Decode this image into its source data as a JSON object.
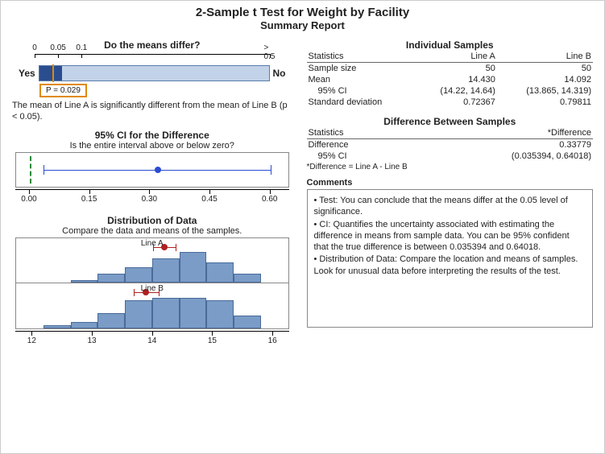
{
  "header": {
    "title": "2-Sample t Test for Weight by Facility",
    "subtitle": "Summary Report"
  },
  "means_differ": {
    "title": "Do the means differ?",
    "yes": "Yes",
    "no": "No",
    "p_label": "P = 0.029",
    "scale_labels": [
      "0",
      "0.05",
      "0.1",
      "> 0.5"
    ],
    "description": "The mean of Line A is significantly different from the mean of Line B (p < 0.05)."
  },
  "ci": {
    "title": "95% CI for the Difference",
    "subtitle": "Is the entire interval above or below zero?",
    "axis_labels": [
      "0.00",
      "0.15",
      "0.30",
      "0.45",
      "0.60"
    ]
  },
  "dist": {
    "title": "Distribution of Data",
    "subtitle": "Compare the data and means of the samples.",
    "label_a": "Line A",
    "label_b": "Line B",
    "axis_labels": [
      "12",
      "13",
      "14",
      "15",
      "16"
    ]
  },
  "individual": {
    "title": "Individual Samples",
    "h_stats": "Statistics",
    "h_a": "Line A",
    "h_b": "Line B",
    "r1": "Sample size",
    "r1a": "50",
    "r1b": "50",
    "r2": "Mean",
    "r2a": "14.430",
    "r2b": "14.092",
    "r3": "95% CI",
    "r3a": "(14.22, 14.64)",
    "r3b": "(13.865, 14.319)",
    "r4": "Standard deviation",
    "r4a": "0.72367",
    "r4b": "0.79811"
  },
  "diff": {
    "title": "Difference Between Samples",
    "h_stats": "Statistics",
    "h_diff": "*Difference",
    "r1": "Difference",
    "r1v": "0.33779",
    "r2": "95% CI",
    "r2v": "(0.035394, 0.64018)",
    "footnote": "*Difference = Line A - Line B"
  },
  "comments": {
    "title": "Comments",
    "b1": "•  Test: You can conclude that the means differ at the 0.05 level of significance.",
    "b2": "•  CI: Quantifies the uncertainty associated with estimating the difference in means from sample data. You can be 95% confident that the true difference is between 0.035394 and 0.64018.",
    "b3": "•  Distribution of Data: Compare the location and means of samples. Look for unusual data before interpreting the results of the test."
  },
  "chart_data": [
    {
      "type": "bar",
      "name": "p-value-indicator",
      "p_value": 0.029,
      "scale": [
        0,
        0.05,
        0.1,
        0.5
      ],
      "significant_region": [
        0,
        0.1
      ]
    },
    {
      "type": "interval",
      "name": "ci-difference",
      "point": 0.33779,
      "lower": 0.035394,
      "upper": 0.64018,
      "reference": 0,
      "xlim": [
        -0.02,
        0.65
      ]
    },
    {
      "type": "bar",
      "name": "distribution-line-a",
      "bin_edges": [
        12.0,
        12.5,
        13.0,
        13.5,
        14.0,
        14.5,
        15.0,
        15.5,
        16.0
      ],
      "counts": [
        0,
        1,
        4,
        7,
        11,
        14,
        9,
        4
      ],
      "mean": 14.43,
      "ci": [
        14.22,
        14.64
      ],
      "xlim": [
        11.5,
        16.5
      ]
    },
    {
      "type": "bar",
      "name": "distribution-line-b",
      "bin_edges": [
        12.0,
        12.5,
        13.0,
        13.5,
        14.0,
        14.5,
        15.0,
        15.5,
        16.0
      ],
      "counts": [
        1,
        2,
        5,
        9,
        10,
        10,
        9,
        4
      ],
      "mean": 14.092,
      "ci": [
        13.865,
        14.319
      ],
      "xlim": [
        11.5,
        16.5
      ]
    }
  ]
}
